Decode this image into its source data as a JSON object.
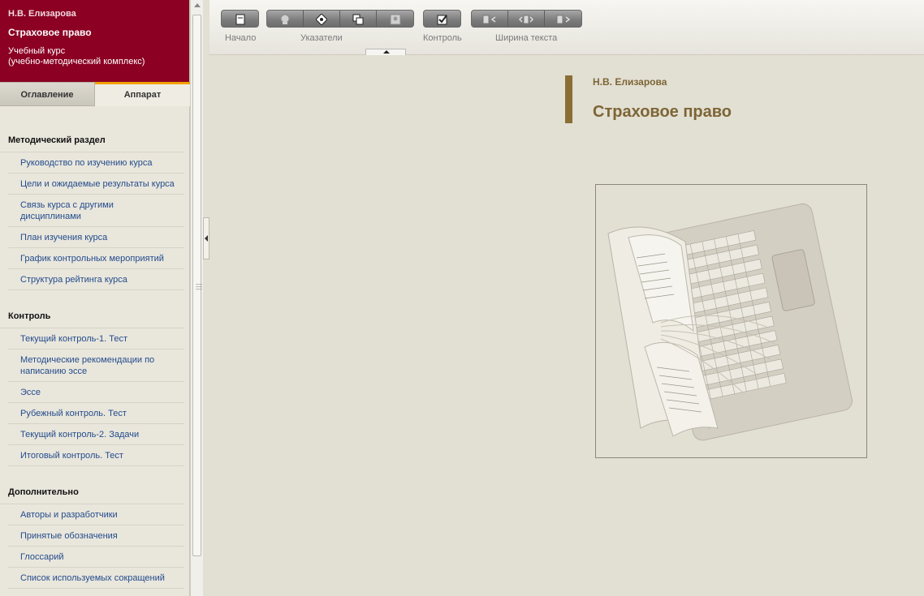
{
  "sidebar": {
    "author": "Н.В. Елизарова",
    "title": "Страховое право",
    "subtitle_line1": "Учебный курс",
    "subtitle_line2": "(учебно-методический комплекс)",
    "tabs": [
      {
        "label": "Оглавление"
      },
      {
        "label": "Аппарат"
      }
    ],
    "sections": [
      {
        "title": "Методический раздел",
        "items": [
          {
            "label": "Руководство по изучению курса"
          },
          {
            "label": "Цели и ожидаемые результаты курса"
          },
          {
            "label": "Связь курса с другими дисциплинами"
          },
          {
            "label": "План изучения курса"
          },
          {
            "label": "График контрольных мероприятий"
          },
          {
            "label": "Структура рейтинга курса"
          }
        ]
      },
      {
        "title": "Контроль",
        "items": [
          {
            "label": "Текущий контроль-1. Тест"
          },
          {
            "label": "Методические рекомендации по написанию эссе"
          },
          {
            "label": "Эссе"
          },
          {
            "label": "Рубежный контроль. Тест"
          },
          {
            "label": "Текущий контроль-2. Задачи"
          },
          {
            "label": "Итоговый контроль. Тест"
          }
        ]
      },
      {
        "title": "Дополнительно",
        "items": [
          {
            "label": "Авторы и разработчики"
          },
          {
            "label": "Принятые обозначения"
          },
          {
            "label": "Глоссарий"
          },
          {
            "label": "Список используемых сокращений"
          }
        ]
      }
    ]
  },
  "toolbar": {
    "groups": [
      {
        "label": "Начало"
      },
      {
        "label": "Указатели"
      },
      {
        "label": "Контроль"
      },
      {
        "label": "Ширина текста"
      }
    ]
  },
  "main": {
    "author": "Н.В. Елизарова",
    "title": "Страховое право"
  },
  "colors": {
    "header_bg": "#8b0023",
    "accent_tab": "#f3a000",
    "title_color": "#7d6535",
    "link_color": "#234c8c"
  }
}
